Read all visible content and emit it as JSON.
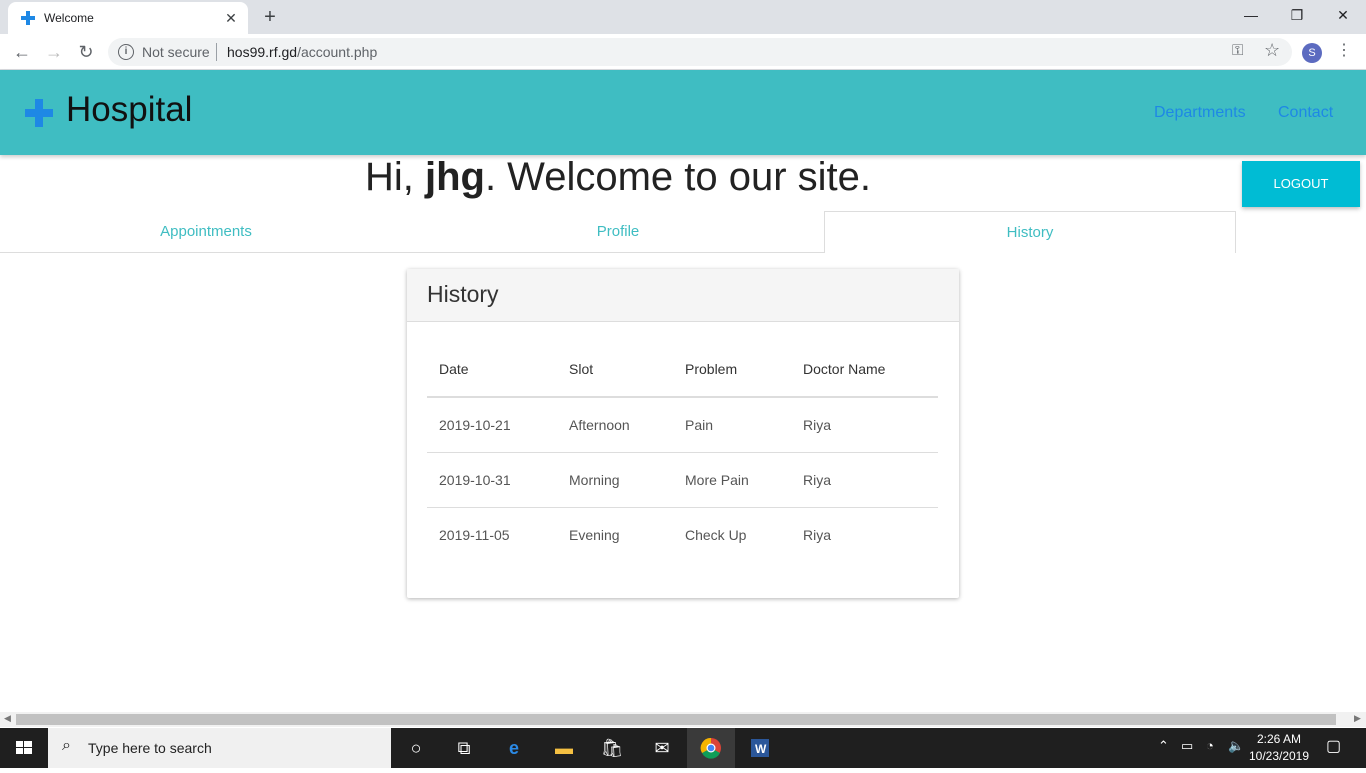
{
  "browser": {
    "tab_title": "Welcome",
    "new_tab": "+",
    "address": {
      "security": "Not secure",
      "host": "hos99.rf.gd",
      "path": "/account.php"
    },
    "profile_initial": "S"
  },
  "site": {
    "title": "Hospital",
    "nav": [
      "Departments",
      "Contact"
    ],
    "brand_color": "#3fbdc2"
  },
  "welcome": {
    "prefix": "Hi, ",
    "username": "jhg",
    "suffix": ". Welcome to our site."
  },
  "logout_label": "LOGOUT",
  "tabs": [
    {
      "label": "Appointments",
      "active": false
    },
    {
      "label": "Profile",
      "active": false
    },
    {
      "label": "History",
      "active": true
    }
  ],
  "history": {
    "title": "History",
    "columns": [
      "Date",
      "Slot",
      "Problem",
      "Doctor Name"
    ],
    "rows": [
      [
        "2019-10-21",
        "Afternoon",
        "Pain",
        "Riya"
      ],
      [
        "2019-10-31",
        "Morning",
        "More Pain",
        "Riya"
      ],
      [
        "2019-11-05",
        "Evening",
        "Check Up",
        "Riya"
      ]
    ]
  },
  "taskbar": {
    "search_placeholder": "Type here to search",
    "time": "2:26 AM",
    "date": "10/23/2019"
  }
}
